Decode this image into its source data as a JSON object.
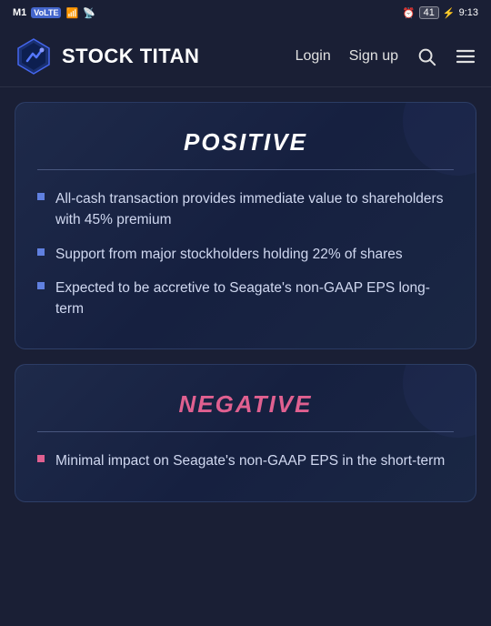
{
  "statusBar": {
    "carrier": "M1",
    "networkType": "VoLTE",
    "signalBars": "|||",
    "wifi": "WiFi",
    "alarmIcon": "⏰",
    "batteryLevel": "41",
    "chargingIcon": "⚡",
    "time": "9:13"
  },
  "navbar": {
    "logoText": "STOCK TITAN",
    "loginLabel": "Login",
    "signupLabel": "Sign up",
    "searchIcon": "search",
    "menuIcon": "menu"
  },
  "cards": [
    {
      "id": "positive",
      "title": "Positive",
      "bullets": [
        "All-cash transaction provides immediate value to shareholders with 45% premium",
        "Support from major stockholders holding 22% of shares",
        "Expected to be accretive to Seagate's non-GAAP EPS long-term"
      ]
    },
    {
      "id": "negative",
      "title": "Negative",
      "bullets": [
        "Minimal impact on Seagate's non-GAAP EPS in the short-term"
      ]
    }
  ]
}
